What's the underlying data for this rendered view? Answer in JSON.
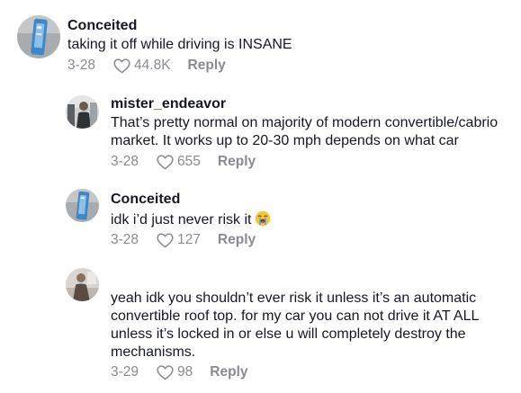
{
  "comments": [
    {
      "username": "Conceited",
      "lines": [
        "taking it off while driving is INSANE"
      ],
      "date": "3-28",
      "likes": "44.8K",
      "reply_label": "Reply",
      "avatar": "phone-avatar"
    },
    {
      "username": "mister_endeavor",
      "lines": [
        "That’s pretty normal on majority of modern convertible/cabrio",
        "market. It works up to 20-30 mph depends on what car"
      ],
      "date": "3-28",
      "likes": "655",
      "reply_label": "Reply",
      "avatar": "person-avatar"
    },
    {
      "username": "Conceited",
      "lines": [
        "idk i’d just never risk it"
      ],
      "emoji": "loudly-crying-face",
      "date": "3-28",
      "likes": "127",
      "reply_label": "Reply",
      "avatar": "phone-avatar"
    },
    {
      "username": "",
      "lines": [
        "yeah idk you shouldn’t ever risk it unless it’s an automatic",
        "convertible roof top. for my car you can not drive it AT ALL",
        "unless it’s locked in or else u will completely destroy the",
        "mechanisms."
      ],
      "date": "3-29",
      "likes": "98",
      "reply_label": "Reply",
      "avatar": "person-avatar"
    }
  ],
  "colors": {
    "username": "#161823",
    "text": "#161823",
    "meta": "#8a8b91"
  }
}
